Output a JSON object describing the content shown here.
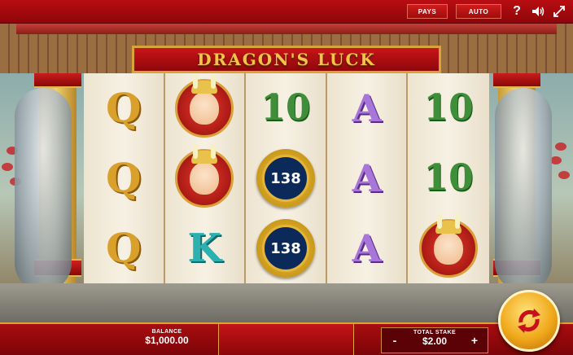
{
  "topbar": {
    "pays_label": "PAYS",
    "auto_label": "AUTO",
    "help_icon": "help-icon",
    "sound_icon": "speaker-icon",
    "fullscreen_icon": "fullscreen-icon"
  },
  "game": {
    "title": "DRAGON'S LUCK"
  },
  "reels": [
    [
      "Q",
      "Q",
      "Q"
    ],
    [
      "medal",
      "medal",
      "K"
    ],
    [
      "10",
      "138",
      "138"
    ],
    [
      "A",
      "A",
      "A"
    ],
    [
      "10",
      "10",
      "medal"
    ]
  ],
  "symbols": {
    "Q": "Q",
    "K": "K",
    "A": "A",
    "ten": "10",
    "coin": "138"
  },
  "footer": {
    "balance_label": "BALANCE",
    "balance_value": "$1,000.00",
    "total_stake_label": "TOTAL STAKE",
    "total_stake_value": "$2.00",
    "minus_label": "-",
    "plus_label": "+",
    "spin_icon": "spin-icon"
  },
  "colors": {
    "accent_red": "#b80d12",
    "gold": "#d8a43a"
  }
}
